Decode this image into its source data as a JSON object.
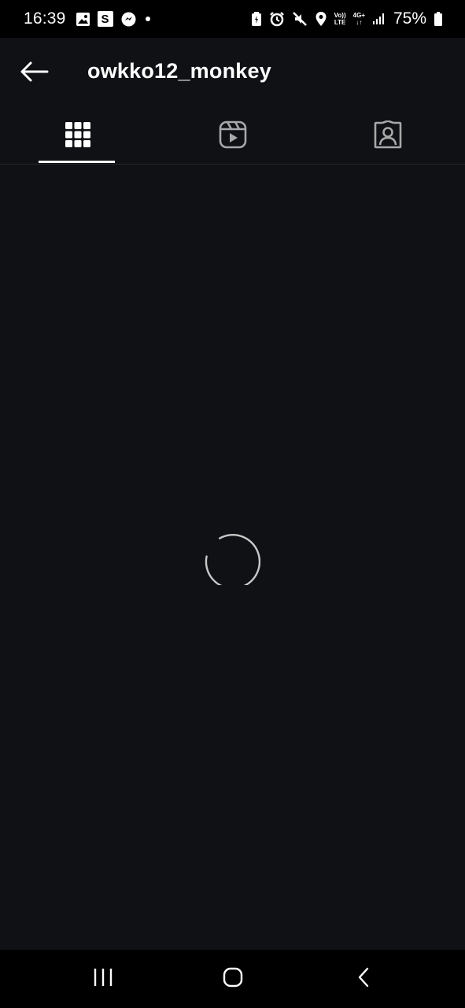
{
  "status_bar": {
    "time": "16:39",
    "left_icons": [
      "gallery-icon",
      "s-app-icon",
      "messenger-icon"
    ],
    "s_badge": "S",
    "volte_top": "Vo))",
    "volte_bottom": "LTE",
    "network_top": "4G+",
    "network_bottom": "↓↑",
    "battery_percent": "75%"
  },
  "header": {
    "back_icon": "arrow-left-icon",
    "username": "owkko12_monkey"
  },
  "tabs": [
    {
      "name": "posts",
      "icon": "grid-icon",
      "selected": true
    },
    {
      "name": "reels",
      "icon": "reels-icon",
      "selected": false
    },
    {
      "name": "tagged",
      "icon": "tagged-person-icon",
      "selected": false
    }
  ],
  "content": {
    "loading": true
  },
  "nav_bar": {
    "recents_icon": "recents-icon",
    "home_icon": "home-icon",
    "back_icon": "back-chevron-icon"
  },
  "colors": {
    "background": "#0f1115",
    "status_bar": "#000000",
    "text": "#ffffff",
    "divider": "#24262b",
    "icon_inactive": "#a8a8a8"
  }
}
